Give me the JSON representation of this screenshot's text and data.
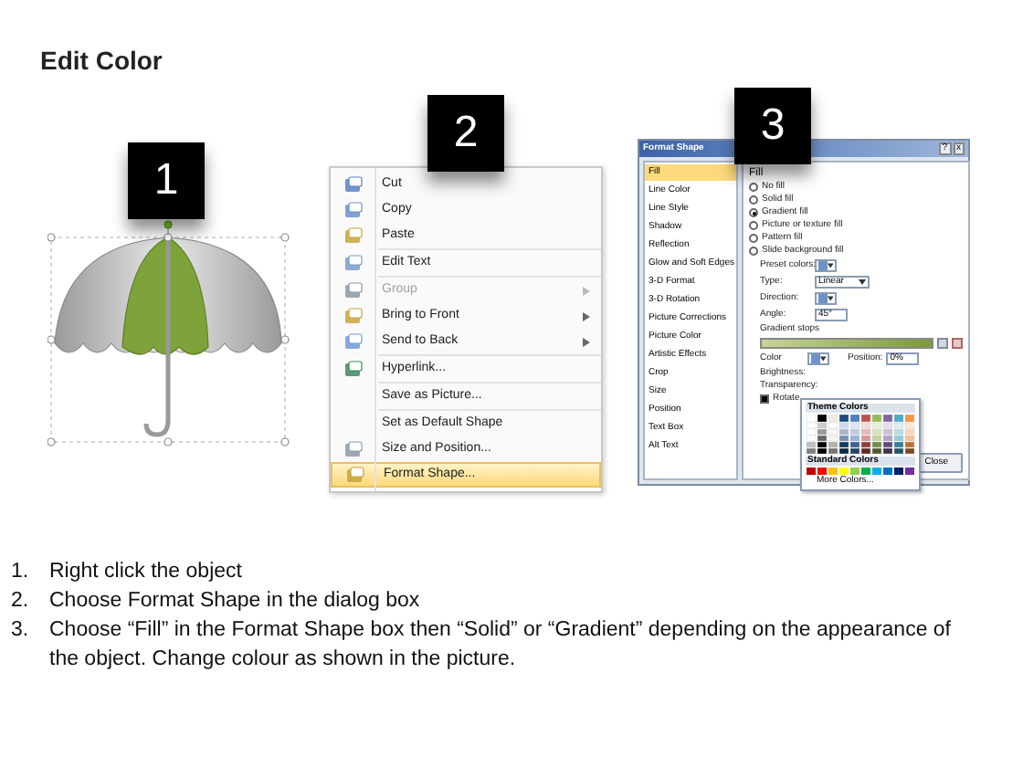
{
  "title": "Edit Color",
  "steps": [
    "1",
    "2",
    "3"
  ],
  "menu": {
    "groups": [
      [
        {
          "label": "Cut",
          "disabled": false,
          "submenu": false,
          "selected": false
        },
        {
          "label": "Copy",
          "disabled": false,
          "submenu": false,
          "selected": false
        },
        {
          "label": "Paste",
          "disabled": false,
          "submenu": false,
          "selected": false
        }
      ],
      [
        {
          "label": "Edit Text",
          "disabled": false,
          "submenu": false,
          "selected": false
        }
      ],
      [
        {
          "label": "Group",
          "disabled": true,
          "submenu": true,
          "selected": false
        },
        {
          "label": "Bring to Front",
          "disabled": false,
          "submenu": true,
          "selected": false
        },
        {
          "label": "Send to Back",
          "disabled": false,
          "submenu": true,
          "selected": false
        }
      ],
      [
        {
          "label": "Hyperlink...",
          "disabled": false,
          "submenu": false,
          "selected": false
        }
      ],
      [
        {
          "label": "Save as Picture...",
          "disabled": false,
          "submenu": false,
          "selected": false
        }
      ],
      [
        {
          "label": "Set as Default Shape",
          "disabled": false,
          "submenu": false,
          "selected": false
        },
        {
          "label": "Size and Position...",
          "disabled": false,
          "submenu": false,
          "selected": false
        },
        {
          "label": "Format Shape...",
          "disabled": false,
          "submenu": false,
          "selected": true
        }
      ]
    ]
  },
  "dialog": {
    "title": "Format Shape",
    "help": "?",
    "close_glyph": "x",
    "nav": [
      {
        "label": "Fill",
        "selected": true
      },
      {
        "label": "Line Color",
        "selected": false
      },
      {
        "label": "Line Style",
        "selected": false
      },
      {
        "label": "Shadow",
        "selected": false
      },
      {
        "label": "Reflection",
        "selected": false
      },
      {
        "label": "Glow and Soft Edges",
        "selected": false
      },
      {
        "label": "3-D Format",
        "selected": false
      },
      {
        "label": "3-D Rotation",
        "selected": false
      },
      {
        "label": "Picture Corrections",
        "selected": false
      },
      {
        "label": "Picture Color",
        "selected": false
      },
      {
        "label": "Artistic Effects",
        "selected": false
      },
      {
        "label": "Crop",
        "selected": false
      },
      {
        "label": "Size",
        "selected": false
      },
      {
        "label": "Position",
        "selected": false
      },
      {
        "label": "Text Box",
        "selected": false
      },
      {
        "label": "Alt Text",
        "selected": false
      }
    ],
    "heading": "Fill",
    "fill_options": [
      {
        "label": "No fill",
        "selected": false
      },
      {
        "label": "Solid fill",
        "selected": false
      },
      {
        "label": "Gradient fill",
        "selected": true
      },
      {
        "label": "Picture or texture fill",
        "selected": false
      },
      {
        "label": "Pattern fill",
        "selected": false
      },
      {
        "label": "Slide background fill",
        "selected": false
      }
    ],
    "preset_label": "Preset colors:",
    "type_label": "Type:",
    "type_value": "Linear",
    "direction_label": "Direction:",
    "angle_label": "Angle:",
    "angle_value": "45°",
    "stops_label": "Gradient stops",
    "color_label": "Color",
    "position_label": "Position:",
    "position_value": "0%",
    "brightness_label": "Brightness:",
    "transparency_label": "Transparency:",
    "rotate": {
      "label": "Rotate",
      "checked": true
    },
    "close_button": "Close",
    "popup": {
      "theme_heading": "Theme Colors",
      "standard_heading": "Standard Colors",
      "more": "More Colors..."
    }
  },
  "instructions": [
    {
      "number": "1.",
      "text": "Right click the object"
    },
    {
      "number": "2.",
      "text": "Choose Format Shape in the dialog box"
    },
    {
      "number": "3.",
      "text": "Choose “Fill” in the Format Shape box then “Solid” or “Gradient” depending on the appearance of the object. Change colour as shown in the picture."
    }
  ]
}
